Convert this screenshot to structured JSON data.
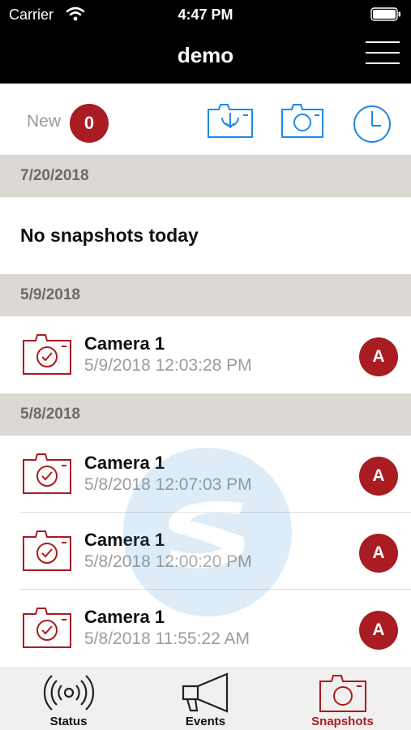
{
  "status_bar": {
    "carrier": "Carrier",
    "time": "4:47 PM"
  },
  "nav": {
    "title": "demo"
  },
  "toolbar": {
    "new_label": "New",
    "new_count": "0"
  },
  "sections": [
    {
      "date": "7/20/2018",
      "empty_text": "No snapshots today"
    },
    {
      "date": "5/9/2018"
    },
    {
      "date": "5/8/2018"
    }
  ],
  "snapshots": {
    "s1": [
      {
        "name": "Camera 1",
        "time": "5/9/2018 12:03:28 PM",
        "badge": "A"
      }
    ],
    "s2": [
      {
        "name": "Camera 1",
        "time": "5/8/2018 12:07:03 PM",
        "badge": "A"
      },
      {
        "name": "Camera 1",
        "time": "5/8/2018 12:00:20 PM",
        "badge": "A"
      },
      {
        "name": "Camera 1",
        "time": "5/8/2018 11:55:22 AM",
        "badge": "A"
      }
    ]
  },
  "tabs": [
    {
      "label": "Status",
      "icon": "broadcast-icon"
    },
    {
      "label": "Events",
      "icon": "megaphone-icon"
    },
    {
      "label": "Snapshots",
      "icon": "camera-icon"
    }
  ],
  "colors": {
    "accent_red": "#a81c22",
    "toolbar_blue": "#1e8ae6",
    "section_header_bg": "#dcd8d3",
    "nav_bg": "#000000"
  }
}
